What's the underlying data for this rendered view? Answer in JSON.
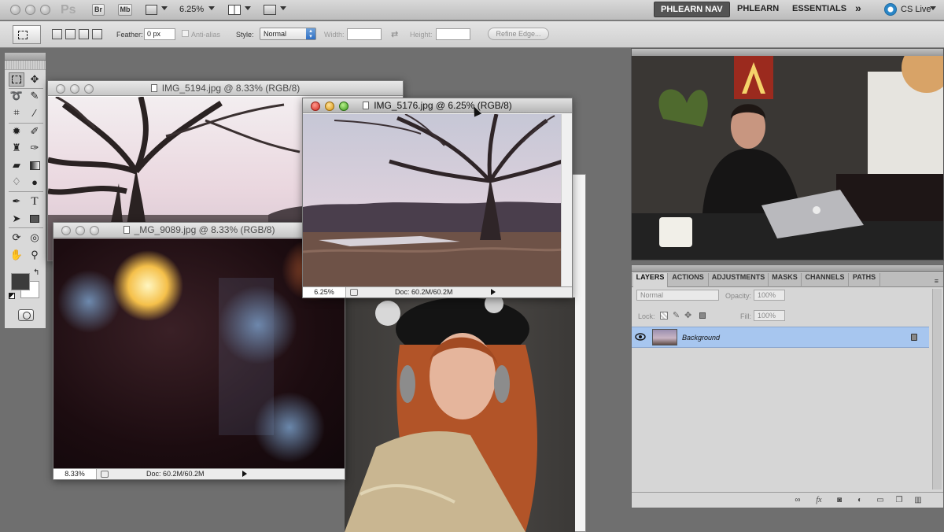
{
  "appbar": {
    "logo": "Ps",
    "br_label": "Br",
    "mb_label": "Mb",
    "zoom_value": "6.25%",
    "workspaces": [
      "PHLEARN NAV",
      "PHLEARN",
      "ESSENTIALS"
    ],
    "active_workspace": "PHLEARN NAV",
    "more_label": "»",
    "cslive_label": "CS Live"
  },
  "options": {
    "feather_label": "Feather:",
    "feather_value": "0 px",
    "antialias_label": "Anti-alias",
    "style_label": "Style:",
    "style_value": "Normal",
    "width_label": "Width:",
    "height_label": "Height:",
    "refine_label": "Refine Edge..."
  },
  "tools": {
    "items": [
      "rectangular-marquee",
      "move",
      "lasso",
      "quick-selection",
      "crop",
      "eyedropper",
      "spot-healing",
      "brush",
      "clone-stamp",
      "history-brush",
      "eraser",
      "gradient",
      "blur",
      "dodge",
      "pen",
      "type",
      "path-selection",
      "rectangle",
      "3d-rotate",
      "3d-orbit",
      "hand",
      "zoom"
    ],
    "type_glyph": "T",
    "fg_color": "#3c3c3c",
    "bg_color": "#ffffff"
  },
  "documents": [
    {
      "title": "IMG_5194.jpg @ 8.33% (RGB/8)"
    },
    {
      "title": "_MG_9089.jpg @ 8.33% (RGB/8)",
      "zoom": "8.33%",
      "doc": "Doc: 60.2M/60.2M"
    },
    {
      "title": "IMG_5176.jpg @ 6.25% (RGB/8)",
      "zoom": "6.25%",
      "doc": "Doc: 60.2M/60.2M",
      "active": true
    }
  ],
  "layers_panel": {
    "tabs": [
      "LAYERS",
      "ACTIONS",
      "ADJUSTMENTS",
      "MASKS",
      "CHANNELS",
      "PATHS"
    ],
    "active_tab": "LAYERS",
    "blend_mode": "Normal",
    "opacity_label": "Opacity:",
    "opacity_value": "100%",
    "lock_label": "Lock:",
    "fill_label": "Fill:",
    "fill_value": "100%",
    "layers": [
      {
        "name": "Background",
        "locked": true,
        "visible": true
      }
    ],
    "selection_color": "#a7c6ef"
  }
}
